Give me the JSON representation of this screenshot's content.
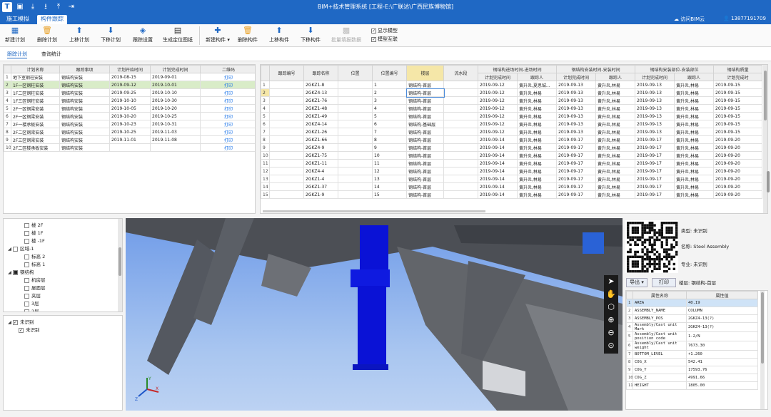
{
  "app": {
    "title": "BIM+技术管理系统 [工程-E:\\广联达\\广西民族博物馆]",
    "logo": "T"
  },
  "tabs": [
    "施工模拟",
    "构件跟踪"
  ],
  "header": {
    "cloud": "访问BIM云",
    "user": "13877191709"
  },
  "ribbon": {
    "buttons": [
      "新建计划",
      "删除计划",
      "上移计划",
      "下移计划",
      "跟踪设置",
      "生成定位图纸",
      "新建构件",
      "删除构件",
      "上移构件",
      "下移构件",
      "批量填报数据"
    ],
    "checks": [
      "显示模型",
      "模型互联"
    ]
  },
  "subtabs": [
    "跟踪计划",
    "查询统计"
  ],
  "plan_table": {
    "headers": [
      "",
      "计划名称",
      "跟踪事项",
      "计划开始时间",
      "计划完成时间",
      "二维码"
    ],
    "rows": [
      [
        "1",
        "地下室钢柱安装",
        "钢结构安装",
        "2019-08-15",
        "2019-09-01",
        "打印"
      ],
      [
        "2",
        "1F一区钢柱安装",
        "钢结构安装",
        "2019-09-12",
        "2019-10-01",
        "打印"
      ],
      [
        "3",
        "1F二区钢柱安装",
        "钢结构安装",
        "2019-09-25",
        "2019-10-10",
        "打印"
      ],
      [
        "4",
        "1F三区钢柱安装",
        "钢结构安装",
        "2019-10-10",
        "2019-10-30",
        "打印"
      ],
      [
        "5",
        "2F一区钢梁安装",
        "钢结构安装",
        "2019-10-05",
        "2019-10-20",
        "打印"
      ],
      [
        "6",
        "2F一区钢梁安装",
        "钢结构安装",
        "2019-10-20",
        "2019-10-25",
        "打印"
      ],
      [
        "7",
        "2F一楼承板安装",
        "钢结构安装",
        "2019-10-23",
        "2019-10-31",
        "打印"
      ],
      [
        "8",
        "2F二区钢梁安装",
        "钢结构安装",
        "2019-10-25",
        "2019-11-03",
        "打印"
      ],
      [
        "9",
        "2F三区钢梁安装",
        "钢结构安装",
        "2019-11-01",
        "2019-11-08",
        "打印"
      ],
      [
        "10",
        "2F二区楼承板安装",
        "钢结构安装",
        "",
        "",
        "打印"
      ]
    ]
  },
  "comp_table": {
    "groups": [
      "钢结构进场时间-进场时间",
      "钢结构安装时间-安装时间",
      "钢结构安装部位-安装部位",
      "钢结构质量"
    ],
    "headers": [
      "",
      "跟踪编号",
      "跟踪名称",
      "位置",
      "位置编号",
      "楼层",
      "流水段",
      "计划完成时间",
      "跟踪人",
      "计划完成时间",
      "跟踪人",
      "计划完成时间",
      "跟踪人",
      "计划完成时"
    ],
    "rows": [
      [
        "1",
        "",
        "2GKZ1-8",
        "",
        "1",
        "钢结构-首层",
        "",
        "2019-09-12",
        "黄升炎,夏思铖...",
        "2019-09-13",
        "黄升炎,林易",
        "2019-09-13",
        "黄升炎,林易",
        "2019-09-15"
      ],
      [
        "2",
        "",
        "2GKZ4-13",
        "",
        "2",
        "钢结构-首层",
        "",
        "2019-09-12",
        "黄升炎,林易",
        "2019-09-13",
        "黄升炎,林易",
        "2019-09-13",
        "黄升炎,林易",
        "2019-09-15"
      ],
      [
        "3",
        "",
        "2GKZ1-76",
        "",
        "3",
        "钢结构-首层",
        "",
        "2019-09-12",
        "黄升炎,林易",
        "2019-09-13",
        "黄升炎,林易",
        "2019-09-13",
        "黄升炎,林易",
        "2019-09-15"
      ],
      [
        "4",
        "",
        "2GKZ1-48",
        "",
        "4",
        "钢结构-首层",
        "",
        "2019-09-12",
        "黄升炎,林易",
        "2019-09-13",
        "黄升炎,林易",
        "2019-09-13",
        "黄升炎,林易",
        "2019-09-15"
      ],
      [
        "5",
        "",
        "2GKZ1-49",
        "",
        "5",
        "钢结构-首层",
        "",
        "2019-09-12",
        "黄升炎,林易",
        "2019-09-13",
        "黄升炎,林易",
        "2019-09-13",
        "黄升炎,林易",
        "2019-09-15"
      ],
      [
        "6",
        "",
        "2GKZ4-14",
        "",
        "6",
        "钢结构-基础层",
        "",
        "2019-09-12",
        "黄升炎,林易",
        "2019-09-13",
        "黄升炎,林易",
        "2019-09-13",
        "黄升炎,林易",
        "2019-09-15"
      ],
      [
        "7",
        "",
        "2GKZ1-26",
        "",
        "7",
        "钢结构-首层",
        "",
        "2019-09-12",
        "黄升炎,林易",
        "2019-09-13",
        "黄升炎,林易",
        "2019-09-13",
        "黄升炎,林易",
        "2019-09-15"
      ],
      [
        "8",
        "",
        "2GKZ1-66",
        "",
        "8",
        "钢结构-首层",
        "",
        "2019-09-14",
        "黄升炎,林易",
        "2019-09-17",
        "黄升炎,林易",
        "2019-09-17",
        "黄升炎,林易",
        "2019-09-20"
      ],
      [
        "9",
        "",
        "2GKZ4-9",
        "",
        "9",
        "钢结构-首层",
        "",
        "2019-09-14",
        "黄升炎,林易",
        "2019-09-17",
        "黄升炎,林易",
        "2019-09-17",
        "黄升炎,林易",
        "2019-09-20"
      ],
      [
        "10",
        "",
        "2GKZ1-75",
        "",
        "10",
        "钢结构-首层",
        "",
        "2019-09-14",
        "黄升炎,林易",
        "2019-09-17",
        "黄升炎,林易",
        "2019-09-17",
        "黄升炎,林易",
        "2019-09-20"
      ],
      [
        "11",
        "",
        "2GKZ1-11",
        "",
        "11",
        "钢结构-首层",
        "",
        "2019-09-14",
        "黄升炎,林易",
        "2019-09-17",
        "黄升炎,林易",
        "2019-09-17",
        "黄升炎,林易",
        "2019-09-20"
      ],
      [
        "12",
        "",
        "2GKZ4-4",
        "",
        "12",
        "钢结构-首层",
        "",
        "2019-09-14",
        "黄升炎,林易",
        "2019-09-17",
        "黄升炎,林易",
        "2019-09-17",
        "黄升炎,林易",
        "2019-09-20"
      ],
      [
        "13",
        "",
        "2GKZ1-4",
        "",
        "13",
        "钢结构-首层",
        "",
        "2019-09-14",
        "黄升炎,林易",
        "2019-09-17",
        "黄升炎,林易",
        "2019-09-17",
        "黄升炎,林易",
        "2019-09-20"
      ],
      [
        "14",
        "",
        "2GKZ1-37",
        "",
        "14",
        "钢结构-首层",
        "",
        "2019-09-14",
        "黄升炎,林易",
        "2019-09-17",
        "黄升炎,林易",
        "2019-09-17",
        "黄升炎,林易",
        "2019-09-20"
      ],
      [
        "15",
        "",
        "2GKZ1-9",
        "",
        "15",
        "钢结构-首层",
        "",
        "2019-09-14",
        "黄升炎,林易",
        "2019-09-17",
        "黄升炎,林易",
        "2019-09-17",
        "黄升炎,林易",
        "2019-09-20"
      ]
    ]
  },
  "tree_top": [
    {
      "label": "楼 2F",
      "depth": 2,
      "toggle": "",
      "check": ""
    },
    {
      "label": "楼 1F",
      "depth": 2,
      "toggle": "",
      "check": ""
    },
    {
      "label": "楼 -1F",
      "depth": 2,
      "toggle": "",
      "check": ""
    },
    {
      "label": "区域-1",
      "depth": 0,
      "toggle": "◢",
      "check": ""
    },
    {
      "label": "标高 2",
      "depth": 2,
      "toggle": "",
      "check": ""
    },
    {
      "label": "标高 1",
      "depth": 2,
      "toggle": "",
      "check": ""
    },
    {
      "label": "钢结构",
      "depth": 0,
      "toggle": "◢",
      "check": "■"
    },
    {
      "label": "机房层",
      "depth": 2,
      "toggle": "",
      "check": ""
    },
    {
      "label": "屋面层",
      "depth": 2,
      "toggle": "",
      "check": ""
    },
    {
      "label": "夹层",
      "depth": 2,
      "toggle": "",
      "check": ""
    },
    {
      "label": "3层",
      "depth": 2,
      "toggle": "",
      "check": ""
    },
    {
      "label": "2层",
      "depth": 2,
      "toggle": "",
      "check": ""
    }
  ],
  "tree_bottom": [
    {
      "label": "未识别",
      "depth": 0,
      "toggle": "◢",
      "check": "✓"
    },
    {
      "label": "未识别",
      "depth": 1,
      "toggle": "",
      "check": "✓"
    }
  ],
  "info": {
    "type_label": "类型:",
    "type_value": "未识别",
    "name_label": "名称:",
    "name_value": "Steel Assembly",
    "major_label": "专业:",
    "major_value": "未识别",
    "floor_label": "楼层:",
    "floor_value": "钢结构-首层",
    "export": "导出",
    "print": "打印"
  },
  "props": {
    "headers": [
      "",
      "属性名称",
      "属性值"
    ],
    "rows": [
      [
        "1",
        "AREA",
        "40.19"
      ],
      [
        "2",
        "ASSEMBLY_NAME",
        "COLUMN"
      ],
      [
        "3",
        "ASSEMBLY_POS",
        "2GKZ4-13(?)"
      ],
      [
        "4",
        "Assembly/Cast unit Mark",
        "2GKZ4-13(?)"
      ],
      [
        "5",
        "Assembly/Cast unit position code",
        "1-2/N"
      ],
      [
        "6",
        "Assembly/Cast unit weight",
        "7673.30"
      ],
      [
        "7",
        "BOTTOM_LEVEL",
        "+1.260"
      ],
      [
        "8",
        "COG_X",
        "542.41"
      ],
      [
        "9",
        "COG_Y",
        "17593.76"
      ],
      [
        "10",
        "COG_Z",
        "4991.66"
      ],
      [
        "11",
        "HEIGHT",
        "1805.00"
      ]
    ]
  },
  "axis": {
    "x": "X",
    "y": "Y",
    "z": "Z"
  },
  "colors": {
    "brand": "#1f68c4",
    "selected_row": "#d9ecc8",
    "column": "#0a12d6"
  }
}
